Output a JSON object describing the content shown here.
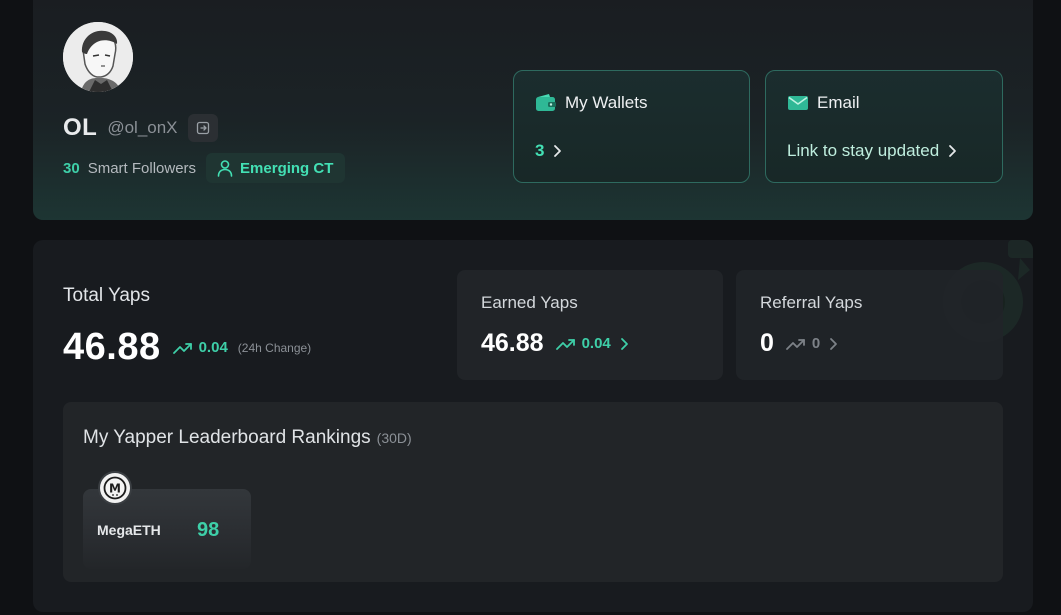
{
  "profile": {
    "display_name": "OL",
    "handle": "@ol_onX",
    "smart_followers_count": "30",
    "smart_followers_label": "Smart Followers",
    "badge_label": "Emerging CT"
  },
  "wallets": {
    "title": "My Wallets",
    "count": "3",
    "icon": "wallet-icon"
  },
  "email": {
    "title": "Email",
    "link_text": "Link to stay updated",
    "icon": "mail-icon"
  },
  "yaps": {
    "total_label": "Total Yaps",
    "total_value": "46.88",
    "total_change": "0.04",
    "change_note": "(24h Change)",
    "earned": {
      "label": "Earned Yaps",
      "value": "46.88",
      "change": "0.04"
    },
    "referral": {
      "label": "Referral Yaps",
      "value": "0",
      "change": "0"
    }
  },
  "leaderboard": {
    "title": "My Yapper Leaderboard Rankings",
    "period": "(30D)",
    "projects": [
      {
        "name": "MegaETH",
        "rank": "98",
        "logo_letter": "M"
      }
    ]
  },
  "colors": {
    "accent": "#3ecfa8",
    "accent_bright": "#43e0b4",
    "background": "#0f1114",
    "panel": "#181b1f"
  }
}
